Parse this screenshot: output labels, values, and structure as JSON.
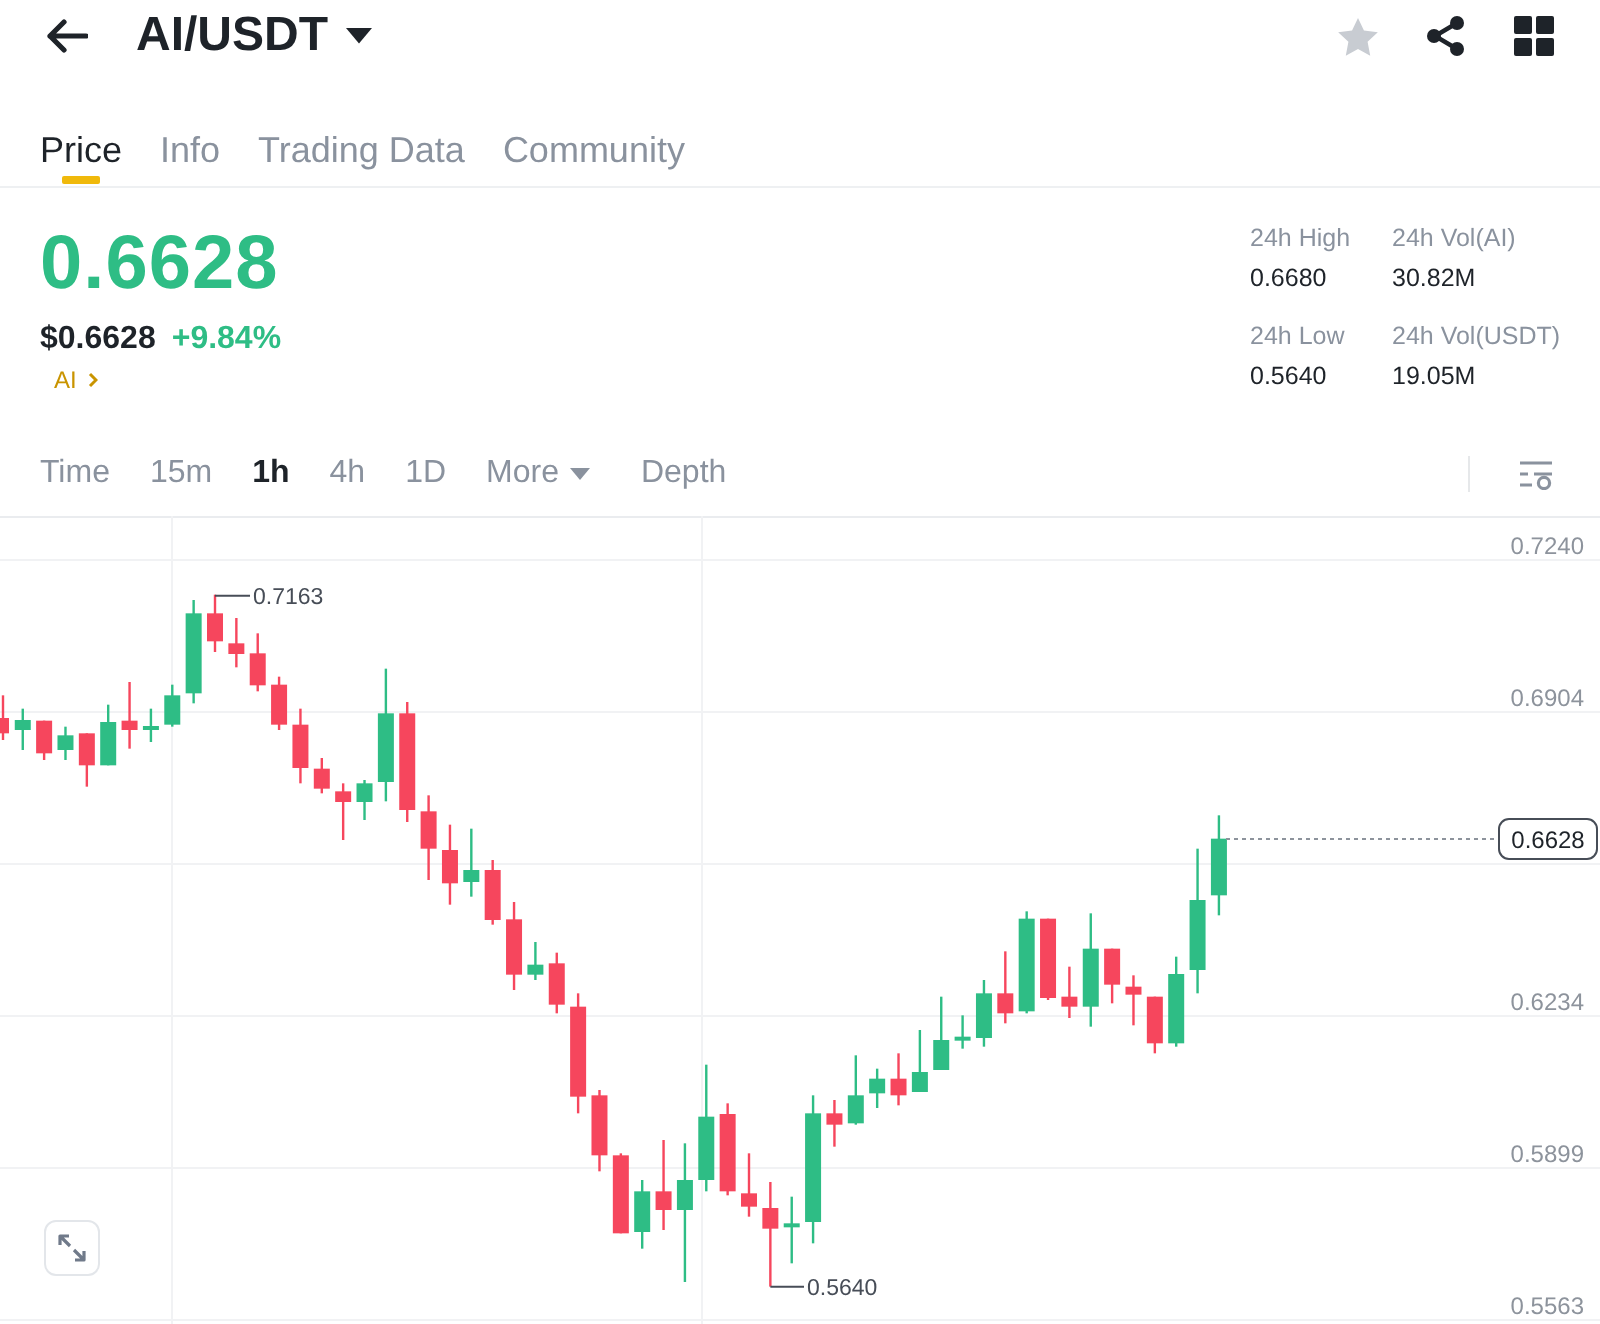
{
  "header": {
    "pair": "AI/USDT",
    "favorite": false
  },
  "tabs": [
    {
      "label": "Price",
      "selected": true
    },
    {
      "label": "Info",
      "selected": false
    },
    {
      "label": "Trading Data",
      "selected": false
    },
    {
      "label": "Community",
      "selected": false
    }
  ],
  "ticker": {
    "last_price": "0.6628",
    "usd_price": "$0.6628",
    "change": "+9.84%",
    "rising": true,
    "base_asset": "AI"
  },
  "stats": [
    {
      "label": "24h High",
      "value": "0.6680"
    },
    {
      "label": "24h Vol(AI)",
      "value": "30.82M"
    },
    {
      "label": "24h Low",
      "value": "0.5640"
    },
    {
      "label": "24h Vol(USDT)",
      "value": "19.05M"
    }
  ],
  "intervals": [
    {
      "label": "Time",
      "kind": "option",
      "selected": false
    },
    {
      "label": "15m",
      "kind": "option",
      "selected": false
    },
    {
      "label": "1h",
      "kind": "option",
      "selected": true
    },
    {
      "label": "4h",
      "kind": "option",
      "selected": false
    },
    {
      "label": "1D",
      "kind": "option",
      "selected": false
    },
    {
      "label": "More",
      "kind": "dropdown",
      "selected": false
    },
    {
      "label": "Depth",
      "kind": "option",
      "selected": false
    }
  ],
  "chart": {
    "price_axis": [
      "0.7240",
      "0.6904",
      "0.6234",
      "0.5899",
      "0.5563"
    ],
    "high_label": "0.7163",
    "low_label": "0.5640",
    "last_price_tag": "0.6628"
  }
}
